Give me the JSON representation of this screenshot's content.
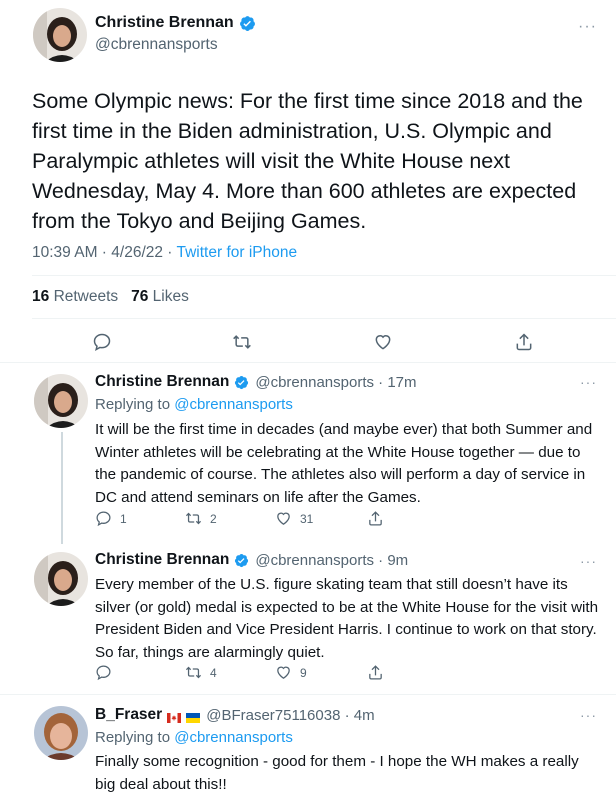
{
  "tweet": {
    "author_name": "Christine Brennan",
    "author_handle": "@cbrennansports",
    "more": "···",
    "text": "Some Olympic news: For the first time since 2018 and the first time in the Biden administration, U.S. Olympic and Paralympic athletes will visit the White House next Wednesday, May 4. More than 600 athletes are expected from the Tokyo and Beijing Games.",
    "time": "10:39 AM",
    "date": "4/26/22",
    "dot": " · ",
    "source": "Twitter for iPhone",
    "retweets_count": "16",
    "retweets_label": "Retweets",
    "likes_count": "76",
    "likes_label": "Likes",
    "icons": [
      "reply-icon",
      "retweet-icon",
      "like-icon",
      "share-icon"
    ]
  },
  "replies": [
    {
      "author_name": "Christine Brennan",
      "handle_time": "@cbrennansports · 17m",
      "replying_prefix": "Replying to ",
      "replying_to": "@cbrennansports",
      "text": "It will be the first time in decades (and maybe ever) that both Summer and Winter athletes will be celebrating at the White House together — due to the pandemic of course. The athletes also will perform a day of service in DC and attend seminars on life after the Games.",
      "reply_count": "1",
      "retweet_count": "2",
      "like_count": "31",
      "more": "···"
    },
    {
      "author_name": "Christine Brennan",
      "handle_time": "@cbrennansports · 9m",
      "text": "Every member of the U.S. figure skating team that still doesn’t have its silver (or gold) medal is expected to be at the White House for the visit with President Biden and Vice President Harris. I continue to work on that story. So far, things are alarmingly quiet.",
      "retweet_count": "4",
      "like_count": "9",
      "more": "···"
    },
    {
      "author_name": "B_Fraser",
      "handle_time": "@BFraser75116038 · 4m",
      "replying_prefix": "Replying to ",
      "replying_to": "@cbrennansports",
      "text": "Finally some recognition - good for them - I hope the WH makes a really big deal about this!!",
      "more": "···"
    }
  ],
  "colors": {
    "accent": "#1d9bf0",
    "text": "#0f1419",
    "secondary": "#536471",
    "border": "#eff3f4"
  }
}
